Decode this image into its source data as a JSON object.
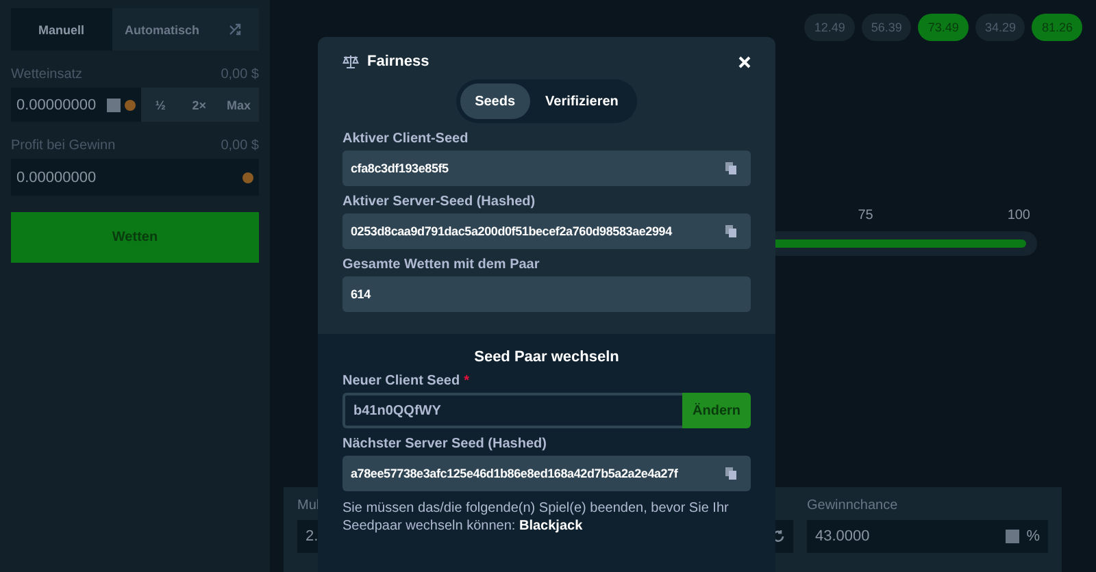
{
  "sidebar": {
    "tabs": [
      {
        "label": "Manuell",
        "selected": true
      },
      {
        "label": "Automatisch",
        "selected": false
      }
    ],
    "bet": {
      "label": "Wetteinsatz",
      "amount": "0,00 $",
      "value": "0.00000000",
      "buttons": [
        "½",
        "2×",
        "Max"
      ]
    },
    "profit": {
      "label": "Profit bei Gewinn",
      "amount": "0,00 $",
      "value": "0.00000000"
    },
    "bet_button": "Wetten"
  },
  "results": [
    {
      "value": "12.49",
      "win": false
    },
    {
      "value": "56.39",
      "win": false
    },
    {
      "value": "73.49",
      "win": true
    },
    {
      "value": "34.29",
      "win": false
    },
    {
      "value": "81.26",
      "win": true
    }
  ],
  "slider": {
    "ticks": [
      "75",
      "100"
    ]
  },
  "bottom_panel": {
    "column_1": {
      "label": "Mul",
      "value": "2."
    },
    "win_chance": {
      "label": "Gewinnchance",
      "value": "43.0000",
      "unit": "%"
    }
  },
  "modal": {
    "title": "Fairness",
    "tabs": [
      {
        "label": "Seeds",
        "selected": true
      },
      {
        "label": "Verifizieren",
        "selected": false
      }
    ],
    "fields": [
      {
        "label": "Aktiver Client-Seed",
        "value": "cfa8c3df193e85f5",
        "copyable": true
      },
      {
        "label": "Aktiver Server-Seed (Hashed)",
        "value": "0253d8caa9d791dac5a200d0f51becef2a760d98583ae2994",
        "copyable": true
      },
      {
        "label": "Gesamte Wetten mit dem Paar",
        "value": "614",
        "copyable": false
      }
    ],
    "change": {
      "heading": "Seed Paar wechseln",
      "new_label": "Neuer Client Seed",
      "required_mark": "*",
      "new_value": "b41n0QQfWY",
      "button": "Ändern",
      "next_label": "Nächster Server Seed (Hashed)",
      "next_value": "a78ee57738e3afc125e46d1b86e8ed168a42d7b5a2a2e4a27f",
      "note": "Sie müssen das/die folgende(n) Spiel(e) beenden, bevor Sie Ihr Seedpaar wechseln können: **Blackjack**"
    }
  }
}
